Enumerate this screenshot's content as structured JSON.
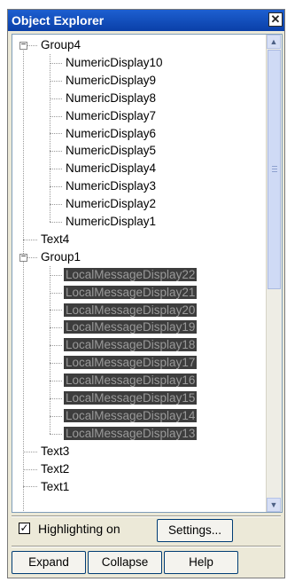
{
  "window": {
    "title": "Object Explorer",
    "close_glyph": "✕"
  },
  "tree": [
    {
      "label": "Group4",
      "level": 0,
      "expander": "−"
    },
    {
      "label": "NumericDisplay10",
      "level": 1
    },
    {
      "label": "NumericDisplay9",
      "level": 1
    },
    {
      "label": "NumericDisplay8",
      "level": 1
    },
    {
      "label": "NumericDisplay7",
      "level": 1
    },
    {
      "label": "NumericDisplay6",
      "level": 1
    },
    {
      "label": "NumericDisplay5",
      "level": 1
    },
    {
      "label": "NumericDisplay4",
      "level": 1
    },
    {
      "label": "NumericDisplay3",
      "level": 1
    },
    {
      "label": "NumericDisplay2",
      "level": 1
    },
    {
      "label": "NumericDisplay1",
      "level": 1
    },
    {
      "label": "Text4",
      "level": 0
    },
    {
      "label": "Group1",
      "level": 0,
      "expander": "−"
    },
    {
      "label": "LocalMessageDisplay22",
      "level": 1,
      "selected": true
    },
    {
      "label": "LocalMessageDisplay21",
      "level": 1,
      "selected": true
    },
    {
      "label": "LocalMessageDisplay20",
      "level": 1,
      "selected": true
    },
    {
      "label": "LocalMessageDisplay19",
      "level": 1,
      "selected": true
    },
    {
      "label": "LocalMessageDisplay18",
      "level": 1,
      "selected": true
    },
    {
      "label": "LocalMessageDisplay17",
      "level": 1,
      "selected": true
    },
    {
      "label": "LocalMessageDisplay16",
      "level": 1,
      "selected": true
    },
    {
      "label": "LocalMessageDisplay15",
      "level": 1,
      "selected": true
    },
    {
      "label": "LocalMessageDisplay14",
      "level": 1,
      "selected": true
    },
    {
      "label": "LocalMessageDisplay13",
      "level": 1,
      "selected": true
    },
    {
      "label": "Text3",
      "level": 0
    },
    {
      "label": "Text2",
      "level": 0
    },
    {
      "label": "Text1",
      "level": 0
    }
  ],
  "scrollbar": {
    "up_glyph": "▲",
    "down_glyph": "▼"
  },
  "options": {
    "highlighting_label": "Highlighting on",
    "highlighting_checked": true,
    "check_glyph": "✓"
  },
  "buttons": {
    "settings": "Settings...",
    "expand": "Expand",
    "collapse": "Collapse",
    "help": "Help"
  },
  "colors": {
    "titlebar": "#0a3fa8",
    "selection": "#3d3d3d",
    "selection_text": "#9a9a9a"
  }
}
